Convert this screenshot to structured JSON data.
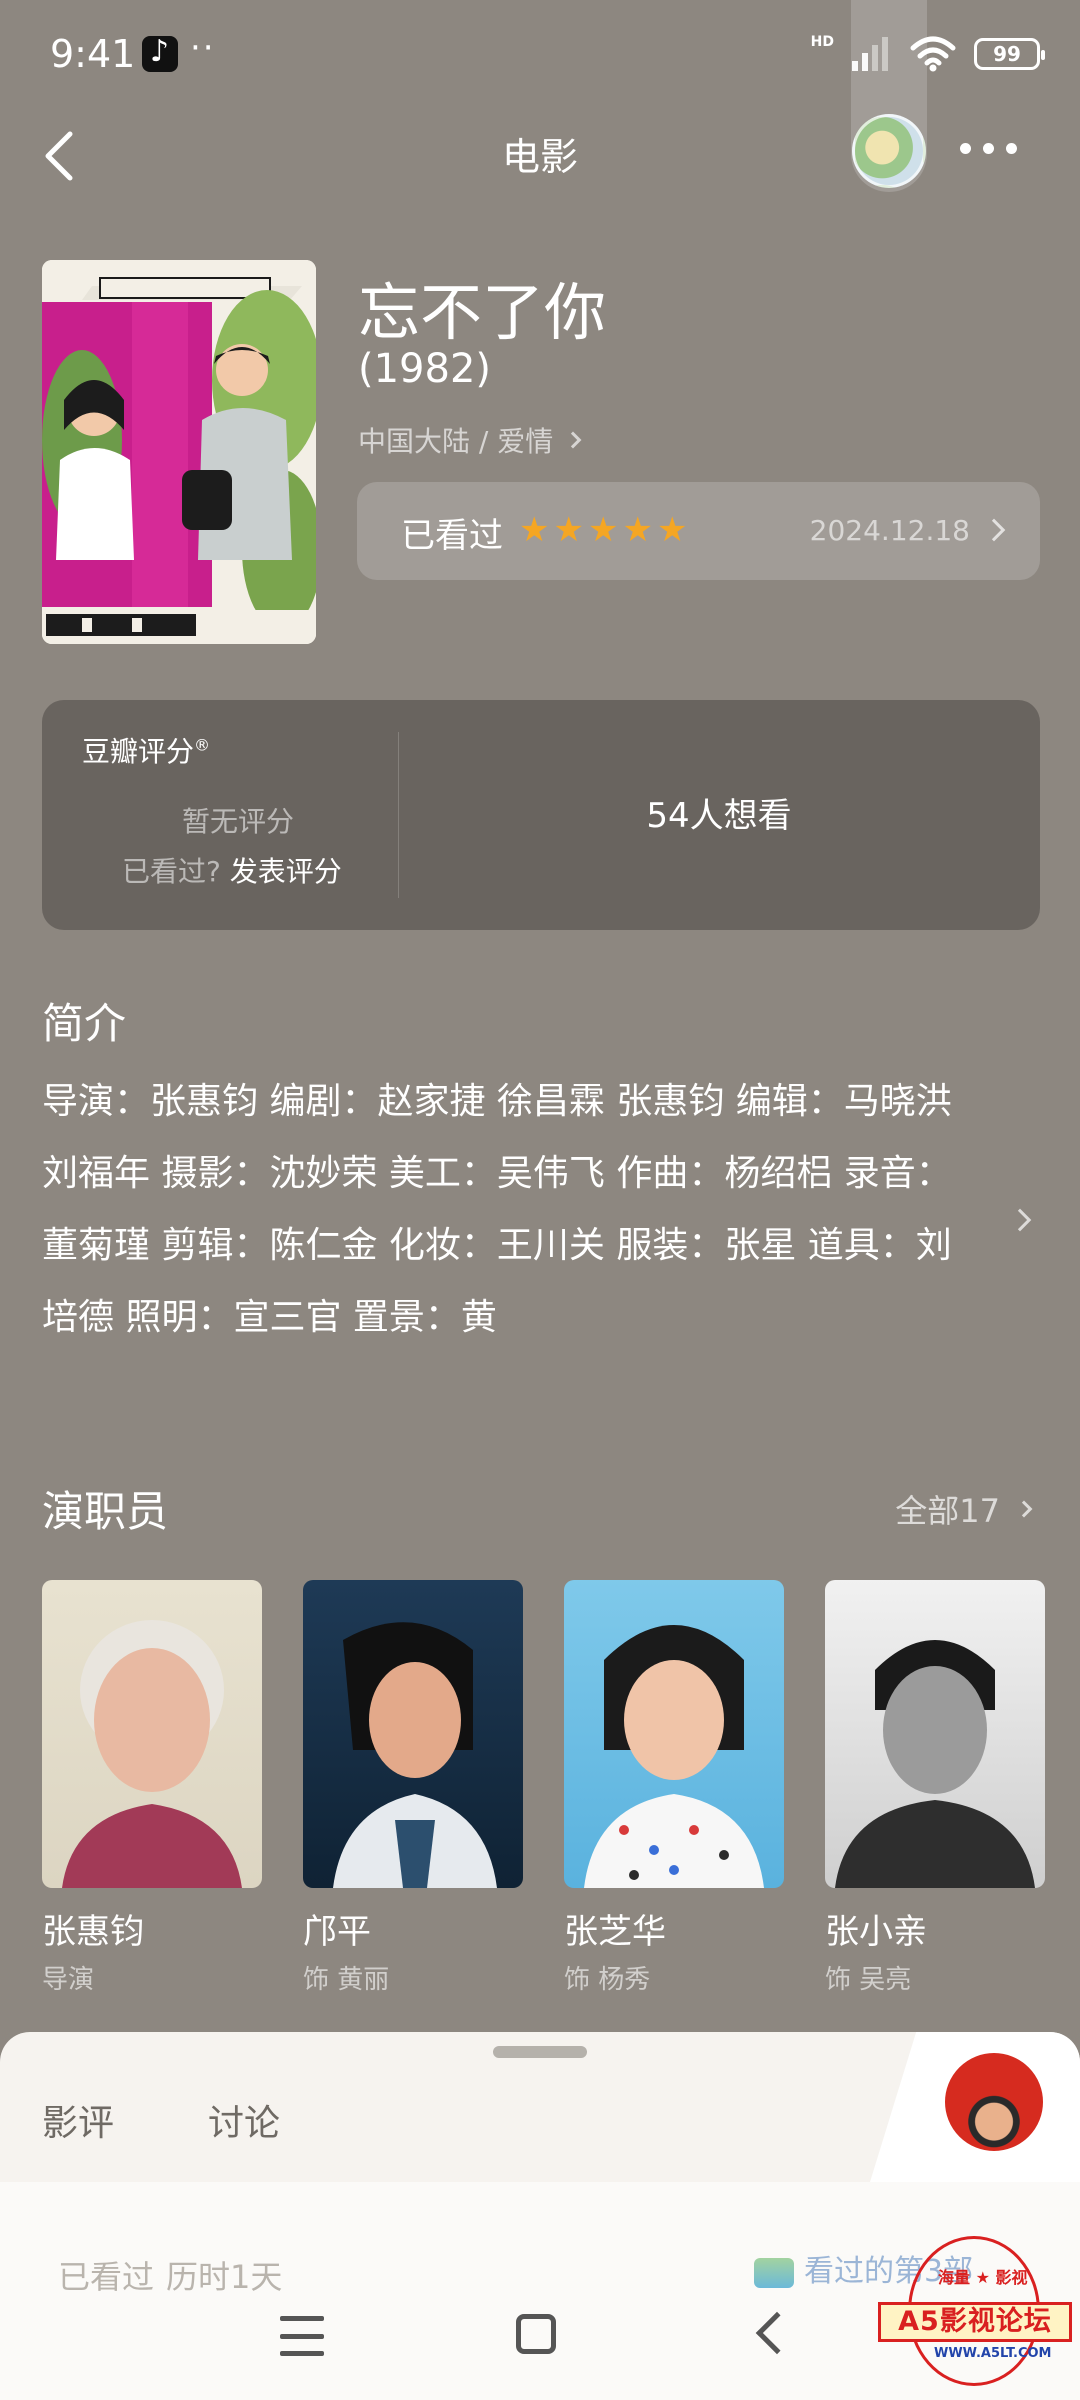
{
  "status_bar": {
    "time": "9:41",
    "dots": "··",
    "hd": "HD",
    "battery": "99"
  },
  "nav": {
    "title": "电影"
  },
  "movie": {
    "title": "忘不了你",
    "year": "(1982)",
    "meta": "中国大陆 / 爱情",
    "watched_label": "已看过",
    "stars": 5,
    "watched_date": "2024.12.18"
  },
  "rating": {
    "title": "豆瓣评分",
    "registered": "®",
    "no_rating": "暂无评分",
    "prompt": "已看过?",
    "action": "发表评分",
    "wish": "54人想看"
  },
  "synopsis": {
    "title": "简介",
    "text": "导演：张惠钧 编剧：赵家捷 徐昌霖 张惠钧 编辑：马晓洪 刘福年 摄影：沈妙荣 美工：吴伟飞 作曲：杨绍梠 录音：董菊瑾 剪辑：陈仁金 化妆：王川关 服装：张星 道具：刘培德 照明：宣三官 置景：黄"
  },
  "cast": {
    "title": "演职员",
    "all_label": "全部17",
    "members": [
      {
        "name": "张惠钧",
        "role": "导演"
      },
      {
        "name": "邝平",
        "role": "饰 黄丽"
      },
      {
        "name": "张芝华",
        "role": "饰 杨秀"
      },
      {
        "name": "张小亲",
        "role": "饰 吴亮"
      }
    ]
  },
  "sheet": {
    "tabs": [
      "影评",
      "讨论"
    ],
    "watched": "已看过",
    "duration": "历时1天",
    "badge": "看过的第3部"
  },
  "watermark": {
    "top": "海量 ★ 影视",
    "name": "A5影视论坛",
    "url": "WWW.A5LT.COM"
  },
  "colors": {
    "background": "#8d8780",
    "star": "#f5a623",
    "sheet": "#f6f3ef"
  }
}
